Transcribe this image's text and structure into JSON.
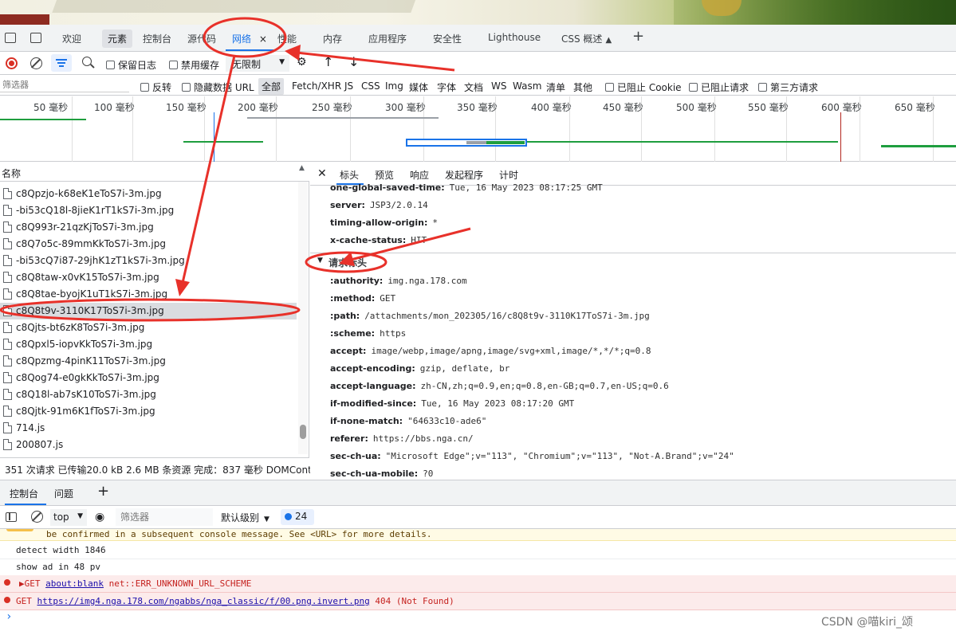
{
  "devtools_tabs": [
    "欢迎",
    "元素",
    "控制台",
    "源代码",
    "网络",
    "性能",
    "内存",
    "应用程序",
    "安全性",
    "Lighthouse",
    "CSS 概述"
  ],
  "network_close": "×",
  "toolbar": {
    "preserve_log": "保留日志",
    "disable_cache": "禁用缓存",
    "throttle": "无限制"
  },
  "filter": {
    "placeholder": "筛选器",
    "invert": "反转",
    "hide_data_url": "隐藏数据 URL",
    "all": "全部",
    "types": [
      "Fetch/XHR",
      "JS",
      "CSS",
      "Img",
      "媒体",
      "字体",
      "文档",
      "WS",
      "Wasm",
      "清单",
      "其他"
    ],
    "blocked_cookie": "已阻止 Cookie",
    "blocked_requests": "已阻止请求",
    "third_party": "第三方请求"
  },
  "timeline": {
    "ticks": [
      "50 毫秒",
      "100 毫秒",
      "150 毫秒",
      "200 毫秒",
      "250 毫秒",
      "300 毫秒",
      "350 毫秒",
      "400 毫秒",
      "450 毫秒",
      "500 毫秒",
      "550 毫秒",
      "600 毫秒",
      "650 毫秒"
    ]
  },
  "request_list": {
    "header": "名称",
    "files": [
      "c8Qpzjo-k68eK1eToS7i-3m.jpg",
      "-bi53cQ18l-8jieK1rT1kS7i-3m.jpg",
      "c8Q993r-21qzKjToS7i-3m.jpg",
      "c8Q7o5c-89mmKkToS7i-3m.jpg",
      "-bi53cQ7i87-29jhK1zT1kS7i-3m.jpg",
      "c8Q8taw-x0vK15ToS7i-3m.jpg",
      "c8Q8tae-byojK1uT1kS7i-3m.jpg",
      "c8Q8t9v-3110K17ToS7i-3m.jpg",
      "c8Qjts-bt6zK8ToS7i-3m.jpg",
      "c8Qpxl5-iopvKkToS7i-3m.jpg",
      "c8Qpzmg-4pinK11ToS7i-3m.jpg",
      "c8Qog74-e0gkKkToS7i-3m.jpg",
      "c8Q18l-ab7sK10ToS7i-3m.jpg",
      "c8Qjtk-91m6K1fToS7i-3m.jpg",
      "714.js",
      "200807.js"
    ],
    "selected_index": 7
  },
  "status_bar": "351 次请求  已传输20.0 kB  2.6 MB 条资源  完成：837 毫秒  DOMConte",
  "detail_tabs": [
    "标头",
    "预览",
    "响应",
    "发起程序",
    "计时"
  ],
  "response_headers": [
    {
      "k": "one-global-saved-time:",
      "v": "Tue, 16 May 2023 08:17:25 GMT"
    },
    {
      "k": "server:",
      "v": "JSP3/2.0.14"
    },
    {
      "k": "timing-allow-origin:",
      "v": "*"
    },
    {
      "k": "x-cache-status:",
      "v": "HIT"
    }
  ],
  "request_headers_title": "请求标头",
  "request_headers": [
    {
      "k": ":authority:",
      "v": "img.nga.178.com"
    },
    {
      "k": ":method:",
      "v": "GET"
    },
    {
      "k": ":path:",
      "v": "/attachments/mon_202305/16/c8Q8t9v-3110K17ToS7i-3m.jpg"
    },
    {
      "k": ":scheme:",
      "v": "https"
    },
    {
      "k": "accept:",
      "v": "image/webp,image/apng,image/svg+xml,image/*,*/*;q=0.8"
    },
    {
      "k": "accept-encoding:",
      "v": "gzip, deflate, br"
    },
    {
      "k": "accept-language:",
      "v": "zh-CN,zh;q=0.9,en;q=0.8,en-GB;q=0.7,en-US;q=0.6"
    },
    {
      "k": "if-modified-since:",
      "v": "Tue, 16 May 2023 08:17:20 GMT"
    },
    {
      "k": "if-none-match:",
      "v": "\"64633c10-ade6\""
    },
    {
      "k": "referer:",
      "v": "https://bbs.nga.cn/"
    },
    {
      "k": "sec-ch-ua:",
      "v": "\"Microsoft Edge\";v=\"113\", \"Chromium\";v=\"113\", \"Not-A.Brand\";v=\"24\""
    },
    {
      "k": "sec-ch-ua-mobile:",
      "v": "?0"
    }
  ],
  "drawer_tabs": [
    "控制台",
    "问题"
  ],
  "console_bar": {
    "context": "top",
    "filter_placeholder": "筛选器",
    "level": "默认级别",
    "issues_count": "24"
  },
  "console_lines": {
    "warn": "be confirmed in a subsequent console message. See <URL> for more details.",
    "log1": "detect width 1846",
    "log2": "show ad in 48 pv",
    "err1_prefix": "▶GET ",
    "err1_link": "about:blank",
    "err1_rest": " net::ERR_UNKNOWN_URL_SCHEME",
    "err2_prefix": "GET ",
    "err2_link": "https://img4.nga.178.com/ngabbs/nga_classic/f/00.png.invert.png",
    "err2_rest": " 404 (Not Found)",
    "prompt": "›"
  },
  "watermark": "CSDN @喵kiri_颂",
  "colors": {
    "accent": "#1a73e8",
    "annotation": "#e8312a",
    "error_bg": "#fcebeb",
    "warn_bg": "#fffbe5",
    "record_red": "#d93025",
    "waterfall_green": "#1e9e3e"
  }
}
